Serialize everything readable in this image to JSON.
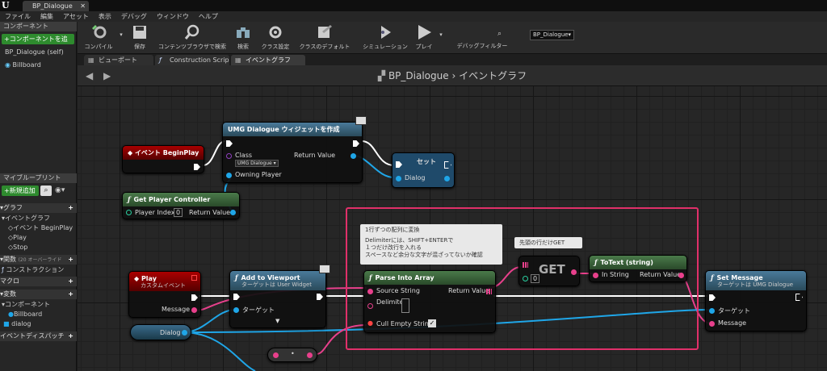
{
  "window": {
    "tab": "BP_Dialogue"
  },
  "menu": [
    "ファイル",
    "編集",
    "アセット",
    "表示",
    "デバッグ",
    "ウィンドウ",
    "ヘルプ"
  ],
  "left": {
    "components_title": "コンポーネント",
    "add_component": "+コンポーネントを追",
    "root": "BP_Dialogue (self)",
    "billboard": "Billboard",
    "mybp_title": "マイブループリント",
    "add_new": "+新規追加",
    "graph": "グラフ",
    "eventgraph": "イベントグラフ",
    "ev_beginplay": "イベント BeginPlay",
    "play": "Play",
    "stop": "Stop",
    "functions": "関数",
    "functions_hint": "(20 オーバーライド",
    "construction": "コンストラクション",
    "macro": "マクロ",
    "vars": "変数",
    "comp_cat": "コンポーネント",
    "var_billboard": "Billboard",
    "var_dialog": "dialog",
    "dispatch": "イベントディスパッチ"
  },
  "toolbar": {
    "compile": "コンパイル",
    "save": "保存",
    "browse": "コンテンツブラウザで検索",
    "search": "検索",
    "class_settings": "クラス設定",
    "class_defaults": "クラスのデフォルト",
    "simulation": "シミュレーション",
    "play": "プレイ",
    "debug_filter": "デバッグフィルター",
    "debug_value": "BP_Dialogue▾"
  },
  "editor_tabs": [
    "ビューポート",
    "Construction Scrip",
    "イベントグラフ"
  ],
  "graph_header": {
    "bp": "BP_Dialogue",
    "sep": "›",
    "graph": "イベントグラフ"
  },
  "nodes": {
    "beginplay": "イベント BeginPlay",
    "create": {
      "title": "UMG Dialogue ウィジェットを作成",
      "class": "Class",
      "class_val": "UMG Dialogue ▾",
      "owner": "Owning Player",
      "ret": "Return Value"
    },
    "set": {
      "title": "セット",
      "pin": "Dialog"
    },
    "gpc": {
      "title": "Get Player Controller",
      "idx": "Player Index",
      "idx_val": "0",
      "ret": "Return Value"
    },
    "play": {
      "title": "Play",
      "sub": "カスタムイベント",
      "msg": "Message"
    },
    "viewport": {
      "title": "Add to Viewport",
      "sub": "ターゲットは User Widget",
      "target": "ターゲット"
    },
    "dialog_var": "Dialog",
    "parse": {
      "title": "Parse Into Array",
      "src": "Source String",
      "delim": "Delimiter",
      "cull": "Cull Empty Strings",
      "ret": "Return Value"
    },
    "get": {
      "title": "GET",
      "idx": "0"
    },
    "totext": {
      "title": "ToText (string)",
      "in": "In String",
      "ret": "Return Value"
    },
    "setmsg": {
      "title": "Set Message",
      "sub": "ターゲットは UMG Dialogue",
      "target": "ターゲット",
      "msg": "Message"
    }
  },
  "comments": {
    "parse_title": "1行ずつの配列に変換",
    "parse_lines": [
      "Delimiterには、SHIFT+ENTERで",
      "１つだけ改行を入れる",
      "スペースなど余分な文字が混ざってないか確認"
    ],
    "get": "先頭の行だけGET"
  },
  "colors": {
    "exec": "#ffffff",
    "object": "#1fa6e8",
    "string": "#e8408c",
    "event_red": "#8b0000",
    "func_green": "#3a6b3a",
    "func_blue": "#2a5a7a",
    "selection": "#e0306a"
  }
}
